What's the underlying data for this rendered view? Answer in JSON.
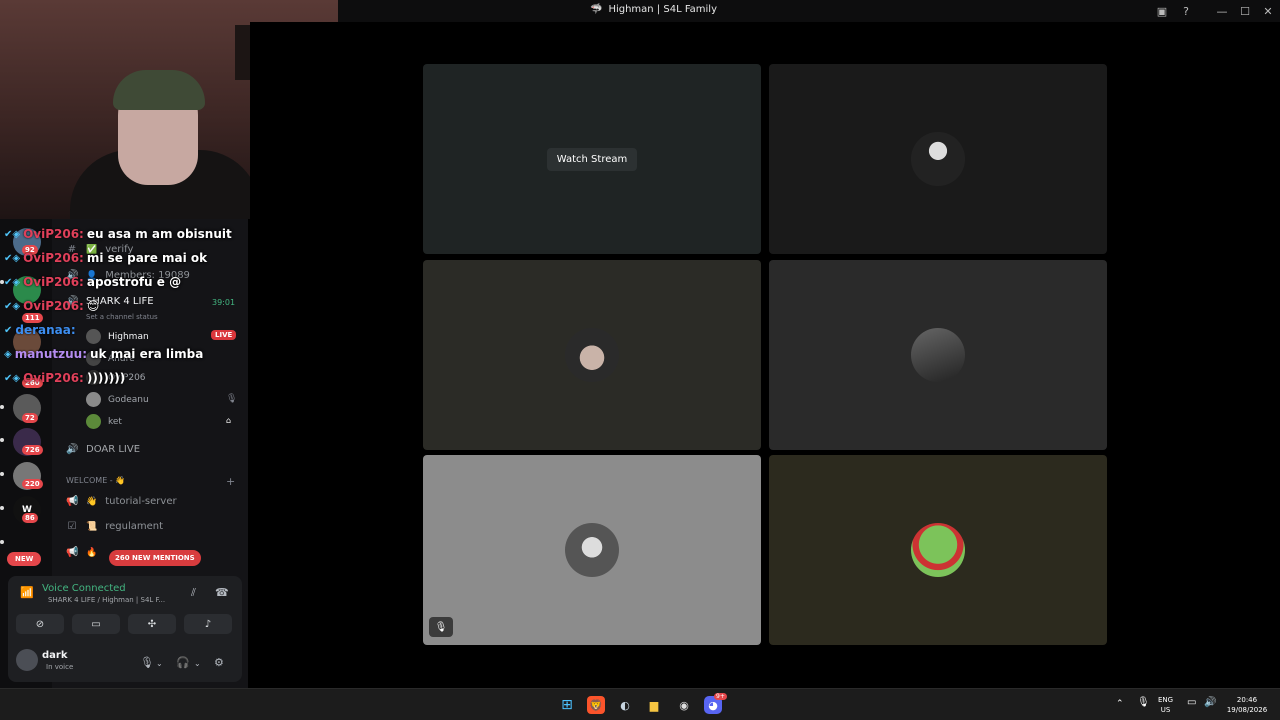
{
  "window": {
    "title": "Highman | S4L Family",
    "minimize": "—",
    "maximize": "☐",
    "close": "✕"
  },
  "rail": {
    "badges": [
      "92",
      "111",
      "260",
      "72",
      "726",
      "220",
      "86"
    ],
    "new_label": "NEW"
  },
  "sidebar": {
    "channels_top": [
      {
        "icon": "#",
        "emoji": "✅",
        "label": "verify"
      },
      {
        "icon": "🔊",
        "emoji": "👤",
        "label": "Members: 19089"
      }
    ],
    "voice_channel": {
      "name": "SHARK 4 LIFE",
      "timer": "39:01",
      "status_hint": "Set a channel status"
    },
    "voice_users": [
      {
        "name": "Highman",
        "live": "LIVE"
      },
      {
        "name": "Andre"
      },
      {
        "name": "OviP206"
      },
      {
        "name": "Godeanu"
      },
      {
        "name": "ket"
      }
    ],
    "doar_live": "DOAR LIVE",
    "category": "WELCOME - 👋",
    "text_channels": [
      {
        "emoji": "👋",
        "label": "tutorial-server"
      },
      {
        "emoji": "📜",
        "label": "regulament"
      },
      {
        "emoji": "🔥",
        "label": ""
      }
    ],
    "mentions_pill": "260 NEW MENTIONS"
  },
  "voice_panel": {
    "status": "Voice Connected",
    "location": "SHARK 4 LIFE / Highman | S4L F...",
    "user_name": "dark",
    "user_status": "In voice"
  },
  "chat": [
    {
      "user": "OviP206:",
      "text": "eu asa m am obisnuit",
      "color": "#e0405a"
    },
    {
      "user": "OviP206:",
      "text": "mi se pare mai ok",
      "color": "#e0405a"
    },
    {
      "user": "OviP206:",
      "text": "apostrofu e @",
      "color": "#e0405a"
    },
    {
      "user": "OviP206:",
      "text": "😊",
      "color": "#e0405a"
    },
    {
      "user": "deranaa:",
      "text": "",
      "color": "#3d8ef0"
    },
    {
      "user": "manutzuu:",
      "text": "uk mai era limba",
      "color": "#b48cf0"
    },
    {
      "user": "OviP206:",
      "text": ")))))))",
      "color": "#e0405a"
    }
  ],
  "stage": {
    "watch_label": "Watch Stream",
    "tile_colors": [
      "#1f2424",
      "#1a1a1a",
      "#2b2b26",
      "#2a2a2a",
      "#8c8c8c",
      "#2c2a1e"
    ]
  },
  "tray": {
    "lang": "ENG",
    "region": "US",
    "time": "20:46",
    "date": "19/08/2026",
    "discord_badge": "9+"
  }
}
